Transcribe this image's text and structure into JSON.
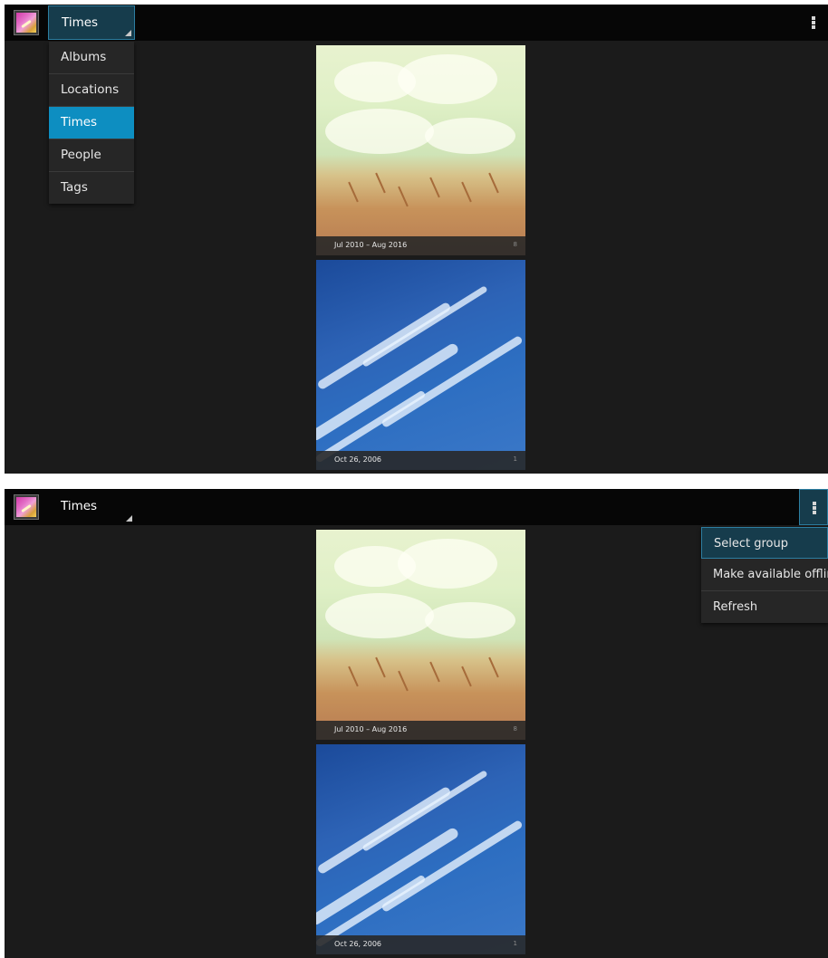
{
  "screens": [
    {
      "action_bar": {
        "spinner_label": "Times"
      },
      "dropdown": {
        "items": [
          "Albums",
          "Locations",
          "Times",
          "People",
          "Tags"
        ],
        "selected": "Times"
      },
      "cards": [
        {
          "title": "Jul 2010 – Aug 2016",
          "count": "8"
        },
        {
          "title": "Oct 26, 2006",
          "count": "1"
        }
      ]
    },
    {
      "action_bar": {
        "spinner_label": "Times"
      },
      "overflow_menu": {
        "items": [
          "Select group",
          "Make available offline",
          "Refresh"
        ]
      },
      "cards": [
        {
          "title": "Jul 2010 – Aug 2016",
          "count": "8"
        },
        {
          "title": "Oct 26, 2006",
          "count": "1"
        }
      ]
    }
  ],
  "colors": {
    "accent_blue": "#0d8ec1",
    "action_bar": "#060606",
    "background": "#1b1b1b",
    "menu_background": "#262626"
  },
  "icons": {
    "app": "gallery-app-icon",
    "overflow": "overflow-menu-icon",
    "spinner": "spinner-corner-icon"
  }
}
